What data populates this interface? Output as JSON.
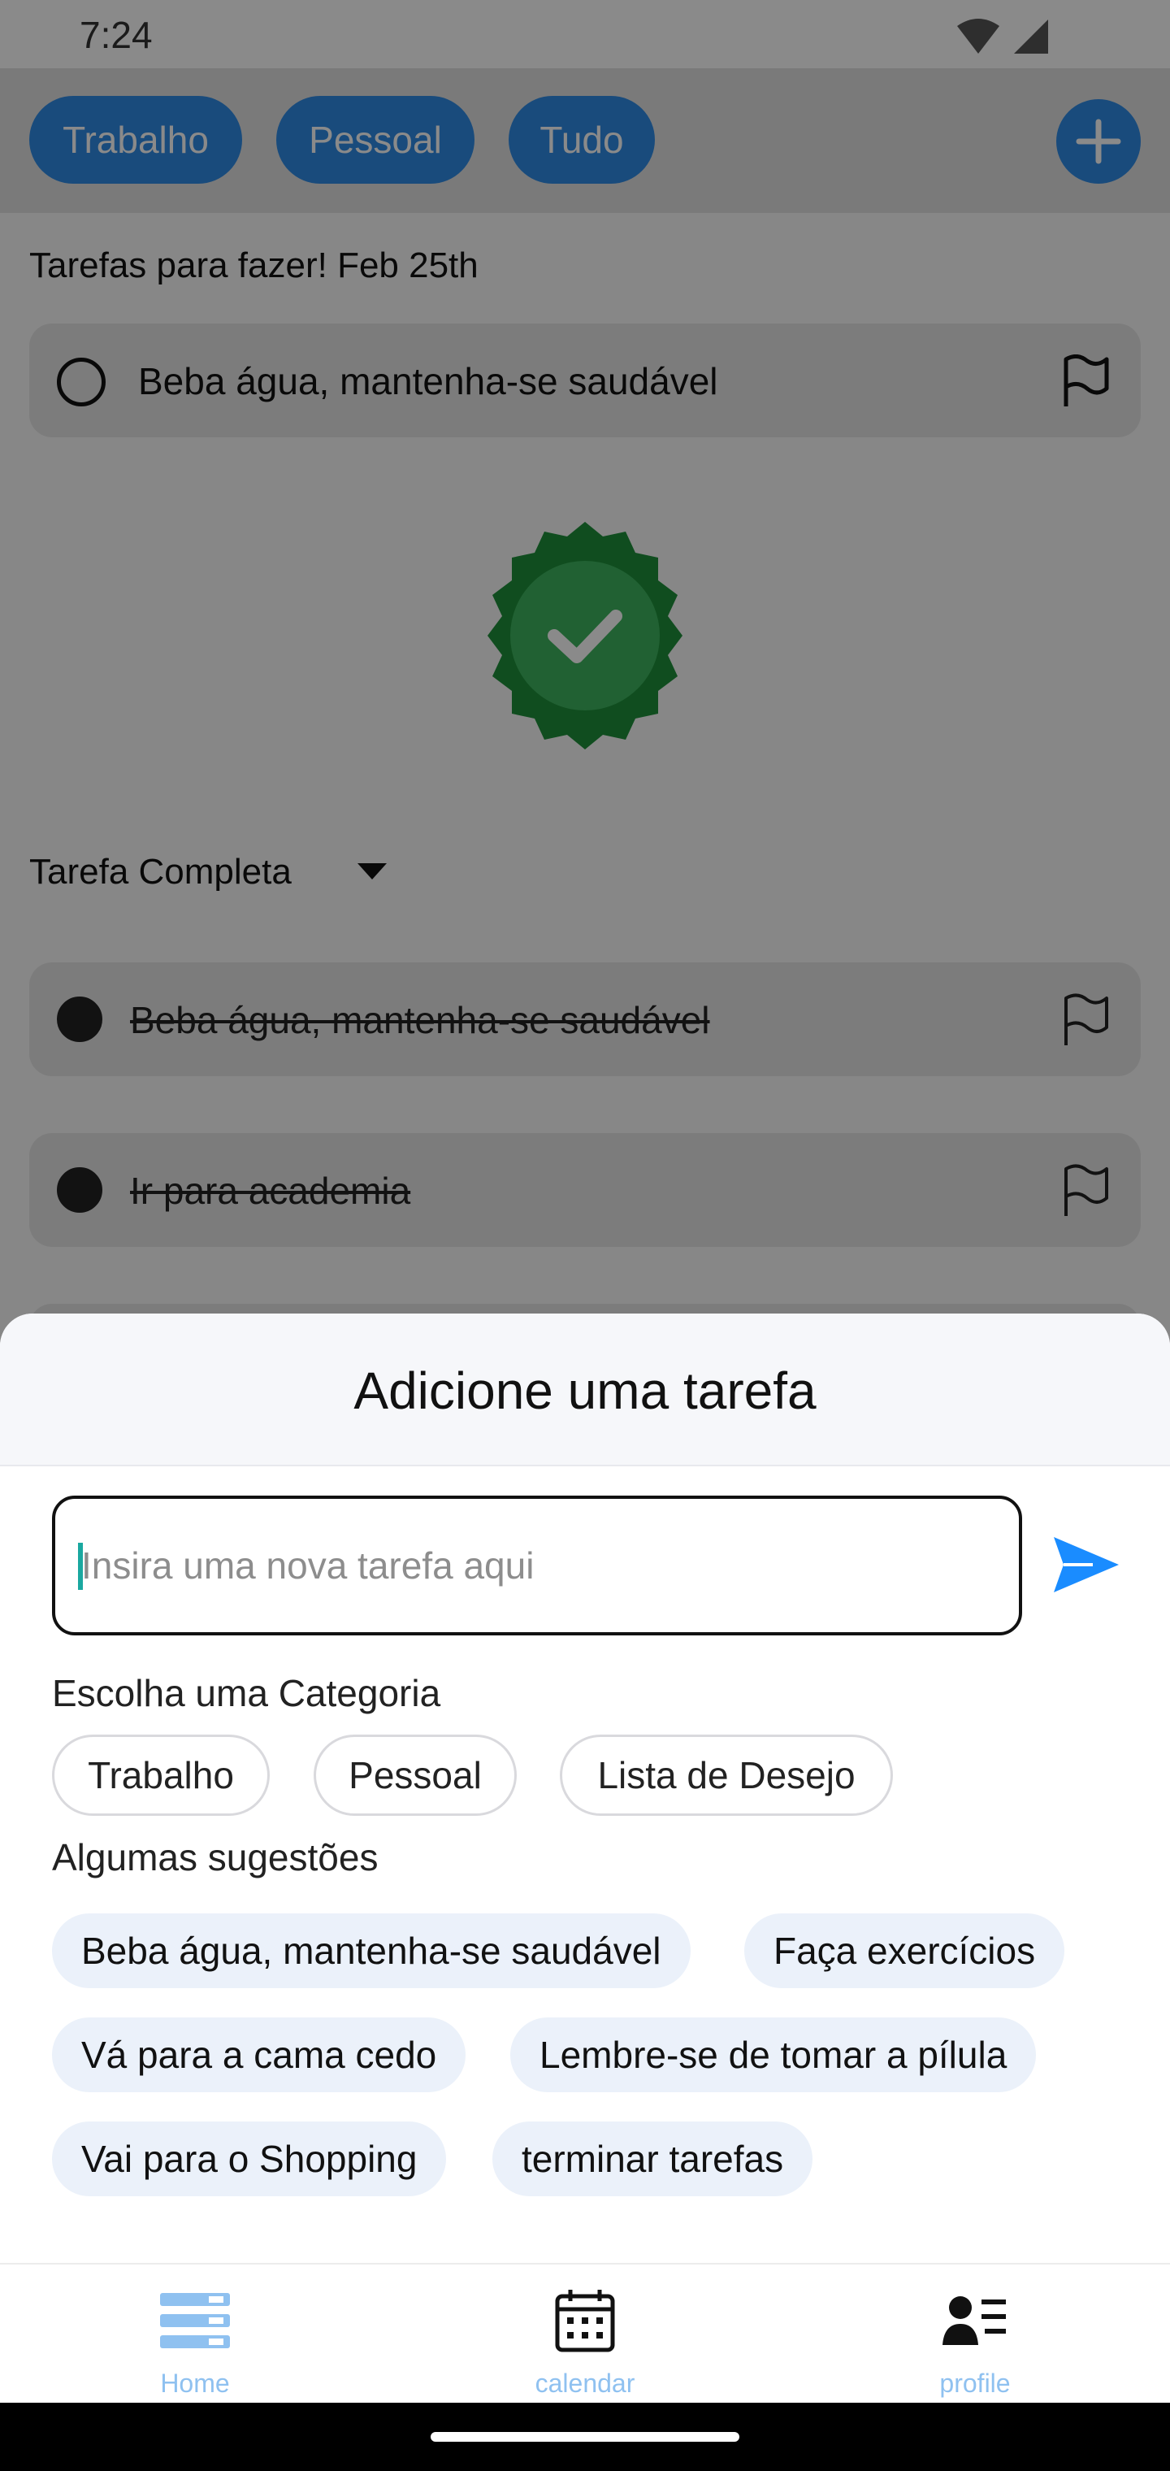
{
  "status_bar": {
    "time": "7:24"
  },
  "top_tabs": {
    "items": [
      {
        "label": "Trabalho"
      },
      {
        "label": "Pessoal"
      },
      {
        "label": "Tudo"
      }
    ]
  },
  "todo_section": {
    "title": "Tarefas para fazer! Feb 25th",
    "tasks": [
      {
        "text": "Beba água, mantenha-se saudável"
      }
    ]
  },
  "completed_section": {
    "title": "Tarefa Completa",
    "tasks": [
      {
        "text": "Beba água, mantenha-se saudável"
      },
      {
        "text": "Ir para academia"
      }
    ]
  },
  "sheet": {
    "title": "Adicione uma tarefa",
    "input": {
      "value": "",
      "placeholder": "Insira uma nova tarefa aqui"
    },
    "category_label": "Escolha uma Categoria",
    "categories": [
      "Trabalho",
      "Pessoal",
      "Lista de Desejo"
    ],
    "suggestions_label": "Algumas sugestões",
    "suggestions": [
      "Beba água, mantenha-se saudável",
      "Faça exercícios",
      "Vá para a cama cedo",
      "Lembre-se de tomar a pílula",
      "Vai para o Shopping",
      "terminar tarefas"
    ]
  },
  "bottom_nav": {
    "items": [
      {
        "label": "Home",
        "icon": "home-list-icon"
      },
      {
        "label": "calendar",
        "icon": "calendar-icon"
      },
      {
        "label": "profile",
        "icon": "profile-icon"
      }
    ]
  },
  "colors": {
    "accent": "#2f8be5",
    "send": "#1a8cff",
    "badge": "#1e8f3a",
    "nav_inactive": "#8fc1f0"
  }
}
